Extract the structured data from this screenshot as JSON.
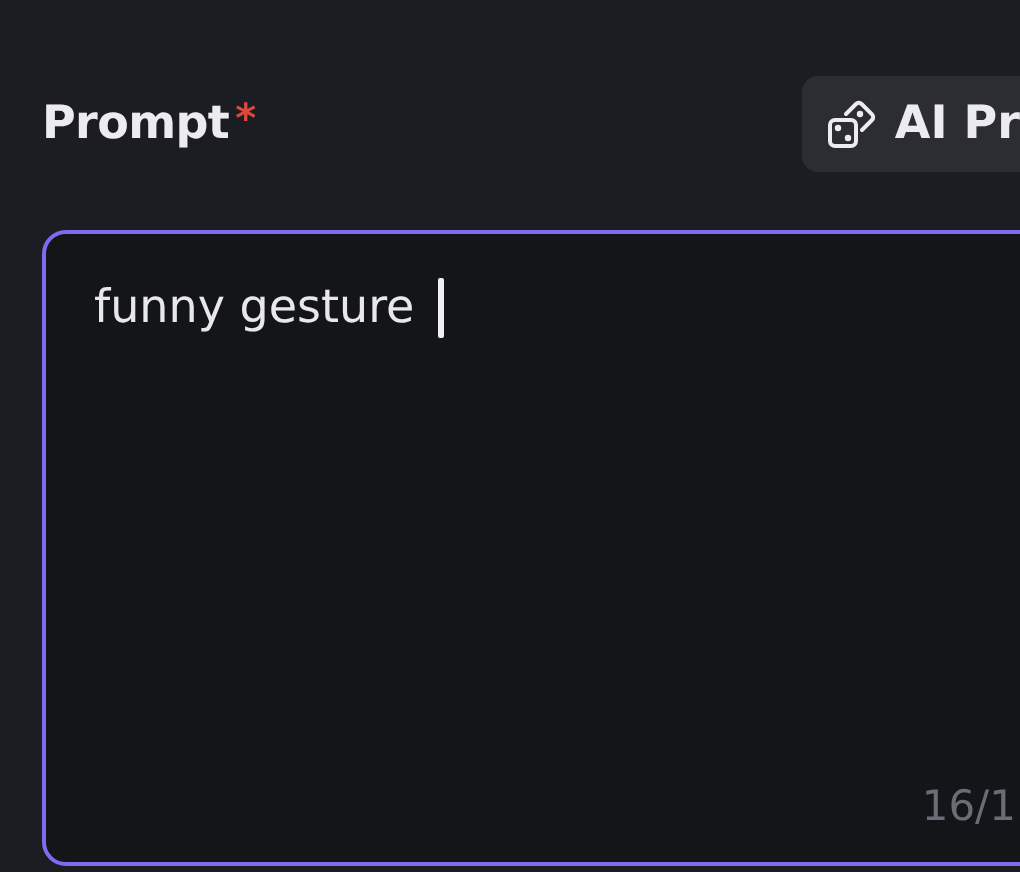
{
  "label": {
    "text": "Prompt",
    "required_mark": "*"
  },
  "ai_button": {
    "label": "AI Pr"
  },
  "prompt_field": {
    "value": "funny gesture ",
    "focused": true,
    "counter": "16/1"
  }
}
